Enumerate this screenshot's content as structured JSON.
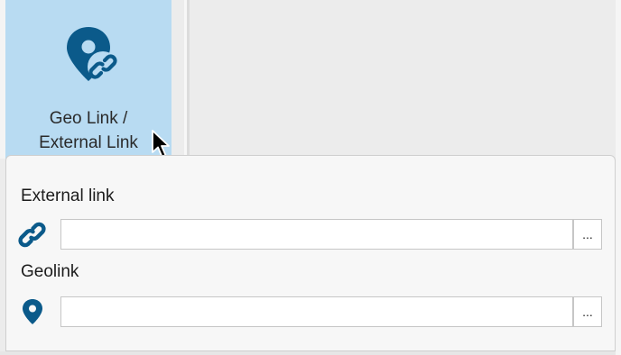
{
  "ribbon": {
    "button": {
      "label_line1": "Geo Link /",
      "label_line2": "External Link",
      "icon": "map-pin-link-icon"
    }
  },
  "panel": {
    "external_link": {
      "label": "External link",
      "icon": "chain-link-icon",
      "value": "",
      "browse_label": "..."
    },
    "geolink": {
      "label": "Geolink",
      "icon": "map-pin-icon",
      "value": "",
      "browse_label": "..."
    }
  },
  "colors": {
    "accent": "#0b5a8a",
    "ribbon_highlight": "#b8dbf2",
    "panel_bg": "#f7f7f7"
  }
}
